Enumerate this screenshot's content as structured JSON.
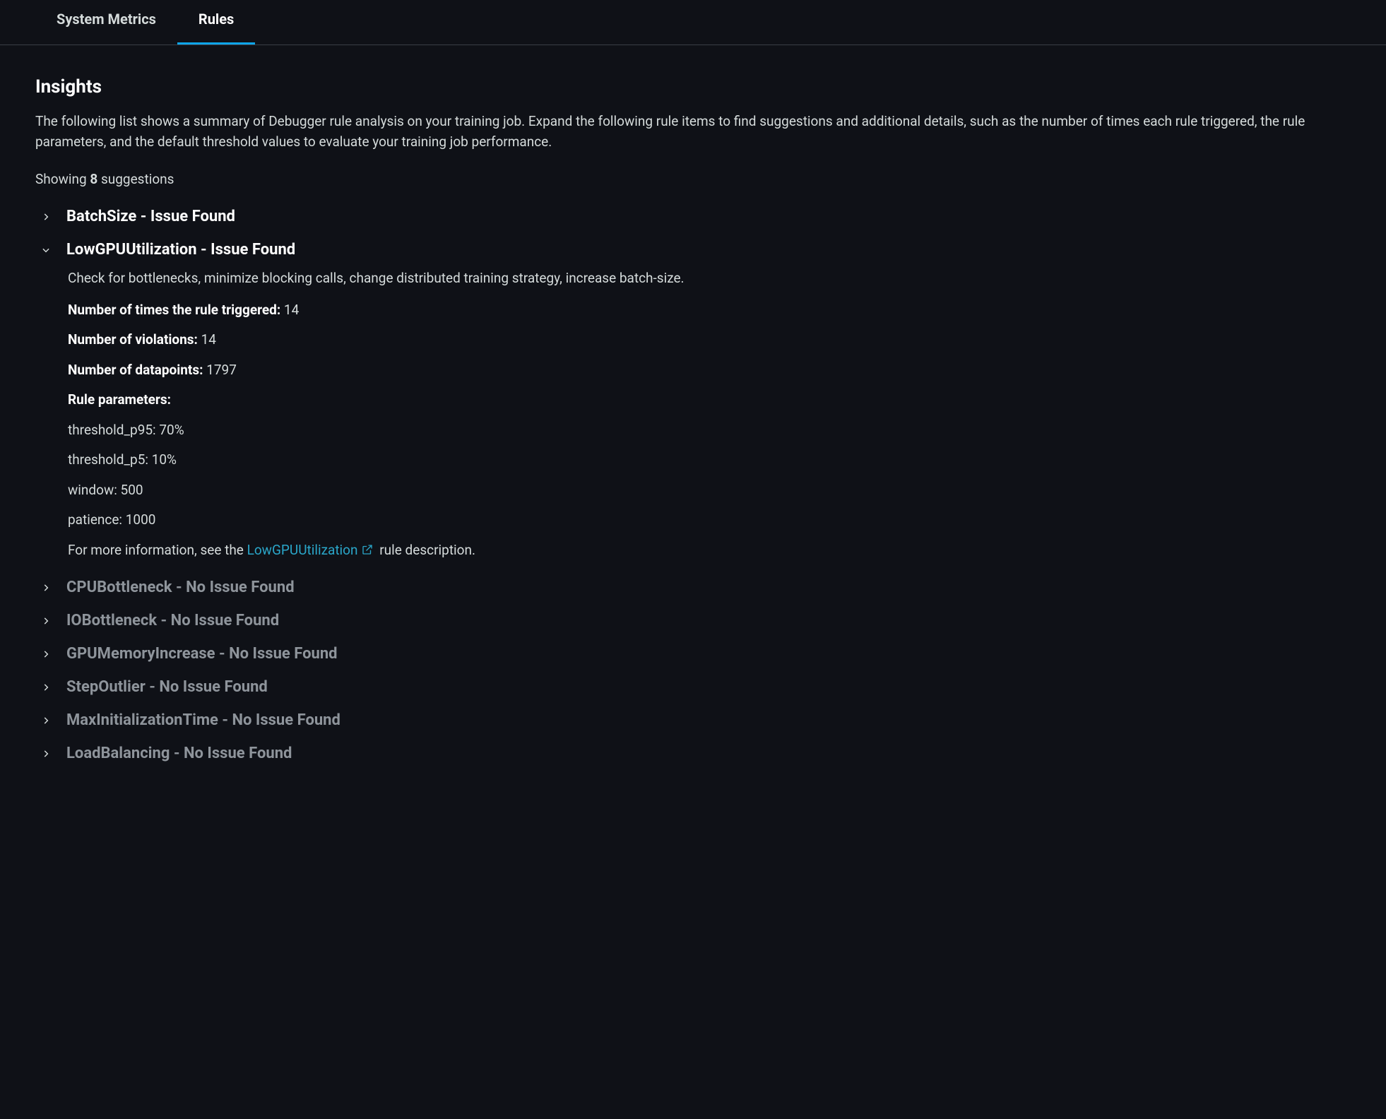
{
  "tabs": {
    "system_metrics": "System Metrics",
    "rules": "Rules"
  },
  "insights": {
    "title": "Insights",
    "description": "The following list shows a summary of Debugger rule analysis on your training job. Expand the following rule items to find suggestions and additional details, such as the number of times each rule triggered, the rule parameters, and the default threshold values to evaluate your training job performance.",
    "showing_prefix": "Showing ",
    "showing_count": "8",
    "showing_suffix": " suggestions"
  },
  "rules": [
    {
      "name": "BatchSize",
      "status": "Issue Found",
      "issue": true,
      "expanded": false
    },
    {
      "name": "LowGPUUtilization",
      "status": "Issue Found",
      "issue": true,
      "expanded": true,
      "detail": {
        "suggestion": "Check for bottlenecks, minimize blocking calls, change distributed training strategy, increase batch-size.",
        "triggered_label": "Number of times the rule triggered:",
        "triggered_value": "14",
        "violations_label": "Number of violations:",
        "violations_value": "14",
        "datapoints_label": "Number of datapoints:",
        "datapoints_value": "1797",
        "params_header": "Rule parameters:",
        "params": [
          "threshold_p95: 70%",
          "threshold_p5: 10%",
          "window: 500",
          "patience: 1000"
        ],
        "more_info_prefix": "For more information, see the ",
        "more_info_link": "LowGPUUtilization",
        "more_info_suffix": " rule description."
      }
    },
    {
      "name": "CPUBottleneck",
      "status": "No Issue Found",
      "issue": false,
      "expanded": false
    },
    {
      "name": "IOBottleneck",
      "status": "No Issue Found",
      "issue": false,
      "expanded": false
    },
    {
      "name": "GPUMemoryIncrease",
      "status": "No Issue Found",
      "issue": false,
      "expanded": false
    },
    {
      "name": "StepOutlier",
      "status": "No Issue Found",
      "issue": false,
      "expanded": false
    },
    {
      "name": "MaxInitializationTime",
      "status": "No Issue Found",
      "issue": false,
      "expanded": false
    },
    {
      "name": "LoadBalancing",
      "status": "No Issue Found",
      "issue": false,
      "expanded": false
    }
  ]
}
